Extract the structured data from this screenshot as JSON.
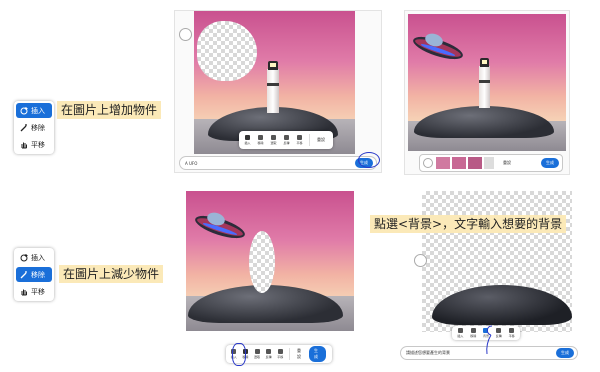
{
  "tool_menu_insert": {
    "items": [
      {
        "label": "插入",
        "icon": "lasso-plus-icon"
      },
      {
        "label": "移除",
        "icon": "wand-icon"
      },
      {
        "label": "平移",
        "icon": "hand-icon"
      }
    ],
    "selected": "插入"
  },
  "tool_menu_remove": {
    "items": [
      {
        "label": "插入",
        "icon": "lasso-plus-icon"
      },
      {
        "label": "移除",
        "icon": "wand-icon"
      },
      {
        "label": "平移",
        "icon": "hand-icon"
      }
    ],
    "selected": "移除"
  },
  "captions": {
    "add": "在圖片上增加物件",
    "remove": "在圖片上減少物件",
    "background": "點選<背景>，文字輸入想要的背景"
  },
  "panel1": {
    "prompt_text": "A UFO",
    "toolbar": [
      "插入",
      "移除",
      "選取",
      "反轉",
      "平移"
    ],
    "reset": "重設",
    "generate": "生成"
  },
  "panel2": {
    "reset": "重設",
    "generate": "生成"
  },
  "panel3": {
    "toolbar": [
      "插入",
      "移除",
      "選取",
      "反轉",
      "平移"
    ],
    "reset": "重設",
    "generate": "生成"
  },
  "panel4": {
    "toolbar": [
      "插入",
      "移除",
      "背景",
      "反轉",
      "平移"
    ],
    "prompt_text": "請描述您想要產生的背景",
    "generate": "生成"
  },
  "colors": {
    "accent": "#1a6fd9",
    "caption_bg": "#fbe9b8",
    "annotation": "#2a39c8"
  }
}
